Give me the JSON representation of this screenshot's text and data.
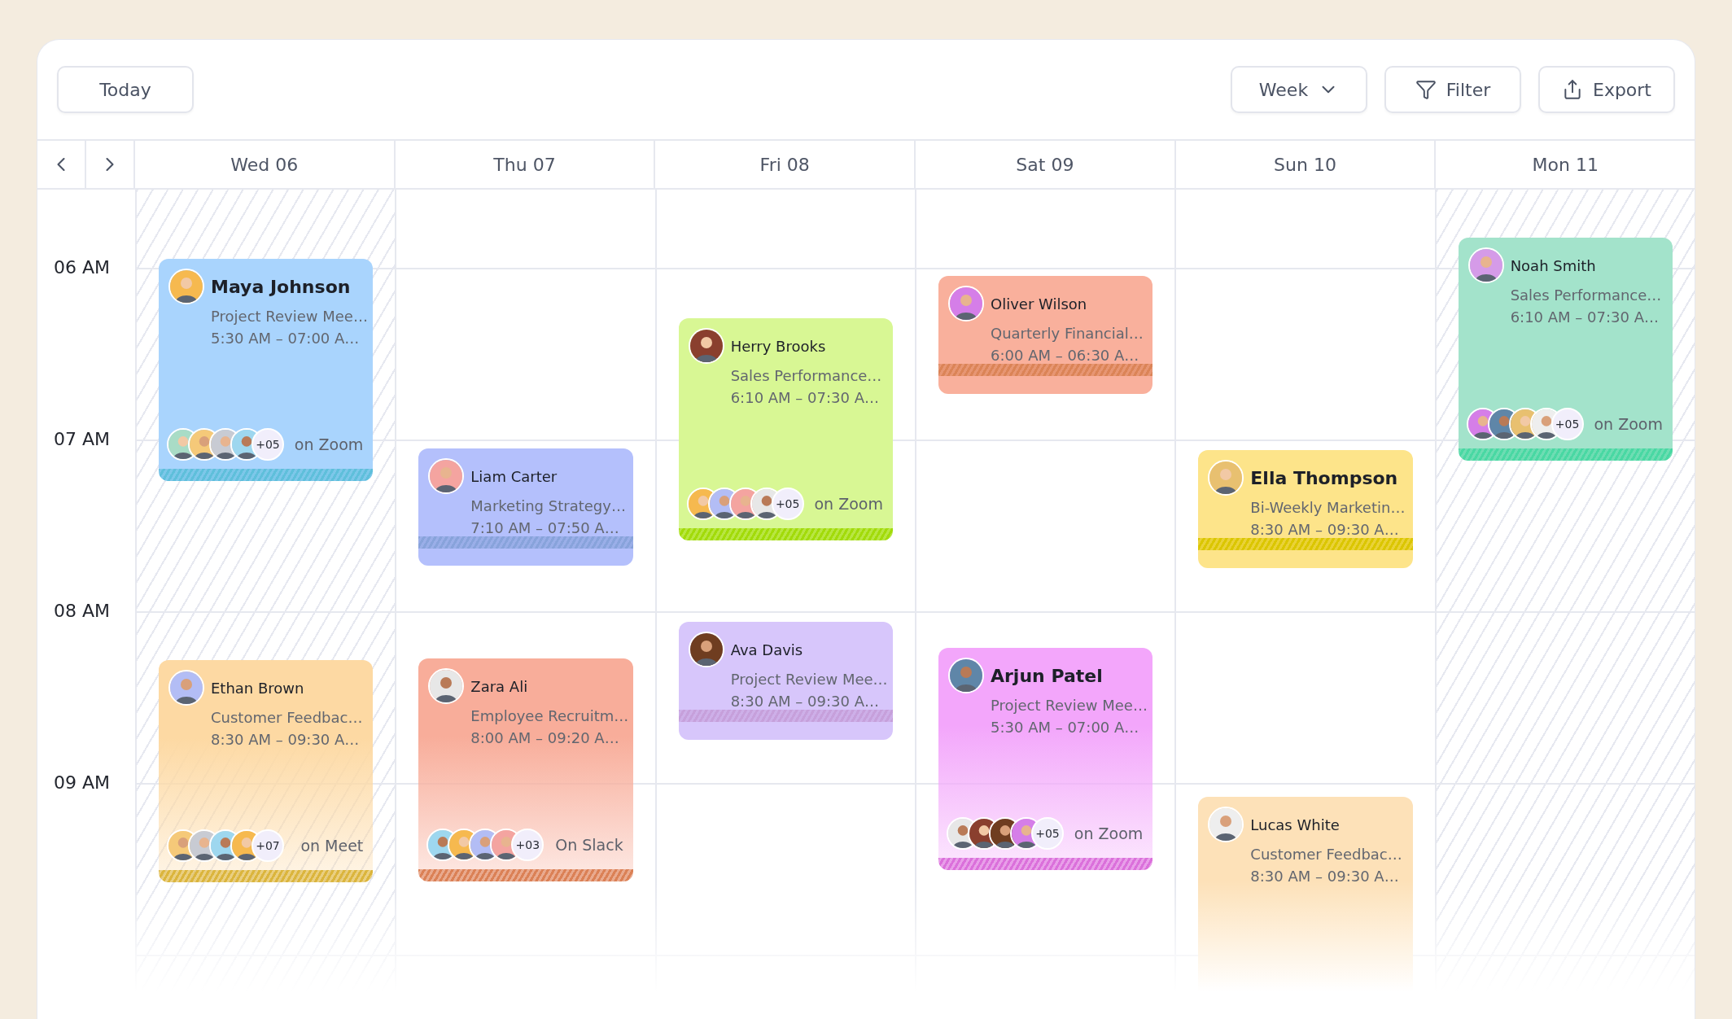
{
  "toolbar": {
    "today": "Today",
    "view": "Week",
    "filter": "Filter",
    "export": "Export"
  },
  "times": [
    "06 AM",
    "07 AM",
    "08 AM",
    "09 AM"
  ],
  "days": [
    {
      "label": "Wed 06",
      "hatched": true,
      "events": [
        {
          "name": "Maya Johnson",
          "kind": "large",
          "title": "Project Review Mee…",
          "time": "5:30 AM – 07:00 A…",
          "color": "#a9d4fd",
          "stripe": true,
          "gradient": false,
          "attendees": {
            "count": "+05",
            "place": "on Zoom"
          }
        },
        {
          "name": "Ethan Brown",
          "kind": "normal",
          "title": "Customer Feedbac…",
          "time": "8:30 AM – 09:30 A…",
          "color": "#fdd9a3",
          "stripe": true,
          "gradient": true,
          "attendees": {
            "count": "+07",
            "place": "on Meet"
          }
        }
      ]
    },
    {
      "label": "Thu 07",
      "hatched": false,
      "events": [
        {
          "name": "Liam Carter",
          "kind": "normal",
          "title": "Marketing Strategy…",
          "time": "7:10 AM – 07:50 A…",
          "color": "#b4c0fc",
          "stripe": true,
          "gradient": false
        },
        {
          "name": "Zara Ali",
          "kind": "normal",
          "title": "Employee Recruitm…",
          "time": "8:00 AM – 09:20 A…",
          "color": "#f8ad9a",
          "stripe": true,
          "gradient": true,
          "attendees": {
            "count": "+03",
            "place": "On Slack"
          }
        }
      ]
    },
    {
      "label": "Fri 08",
      "hatched": false,
      "events": [
        {
          "name": "Herry Brooks",
          "kind": "normal",
          "title": "Sales Performance…",
          "time": "6:10 AM – 07:30 A…",
          "color": "#d8f794",
          "stripe": true,
          "gradient": false,
          "attendees": {
            "count": "+05",
            "place": "on Zoom"
          }
        },
        {
          "name": "Ava Davis",
          "kind": "normal",
          "title": "Project Review Mee…",
          "time": "8:30 AM – 09:30 A…",
          "color": "#d7c6fb",
          "stripe": true,
          "gradient": false
        }
      ]
    },
    {
      "label": "Sat 09",
      "hatched": false,
      "events": [
        {
          "name": "Oliver Wilson",
          "kind": "normal",
          "title": "Quarterly Financial…",
          "time": "6:00 AM – 06:30 A…",
          "color": "#f9b09c",
          "stripe": true,
          "gradient": false
        },
        {
          "name": "Arjun Patel",
          "kind": "large",
          "title": "Project Review Mee…",
          "time": "5:30 AM – 07:00 A…",
          "color": "#f3a6fb",
          "stripe": true,
          "gradient": true,
          "attendees": {
            "count": "+05",
            "place": "on Zoom"
          }
        }
      ]
    },
    {
      "label": "Sun 10",
      "hatched": false,
      "events": [
        {
          "name": "Ella Thompson",
          "kind": "large",
          "title": "Bi-Weekly Marketin…",
          "time": "8:30 AM – 09:30 A…",
          "color": "#fde48a",
          "stripe": true,
          "gradient": false
        },
        {
          "name": "Lucas White",
          "kind": "normal",
          "title": "Customer Feedbac…",
          "time": "8:30 AM – 09:30 A…",
          "color": "#fde1b8",
          "stripe": false
        }
      ]
    },
    {
      "label": "Mon 11",
      "hatched": true,
      "events": [
        {
          "name": "Noah Smith",
          "kind": "normal",
          "title": "Sales Performance…",
          "time": "6:10 AM – 07:30 A…",
          "color": "#a3e3cb",
          "stripe": true,
          "gradient": false,
          "attendees": {
            "count": "+05",
            "place": "on Zoom"
          }
        }
      ]
    }
  ]
}
